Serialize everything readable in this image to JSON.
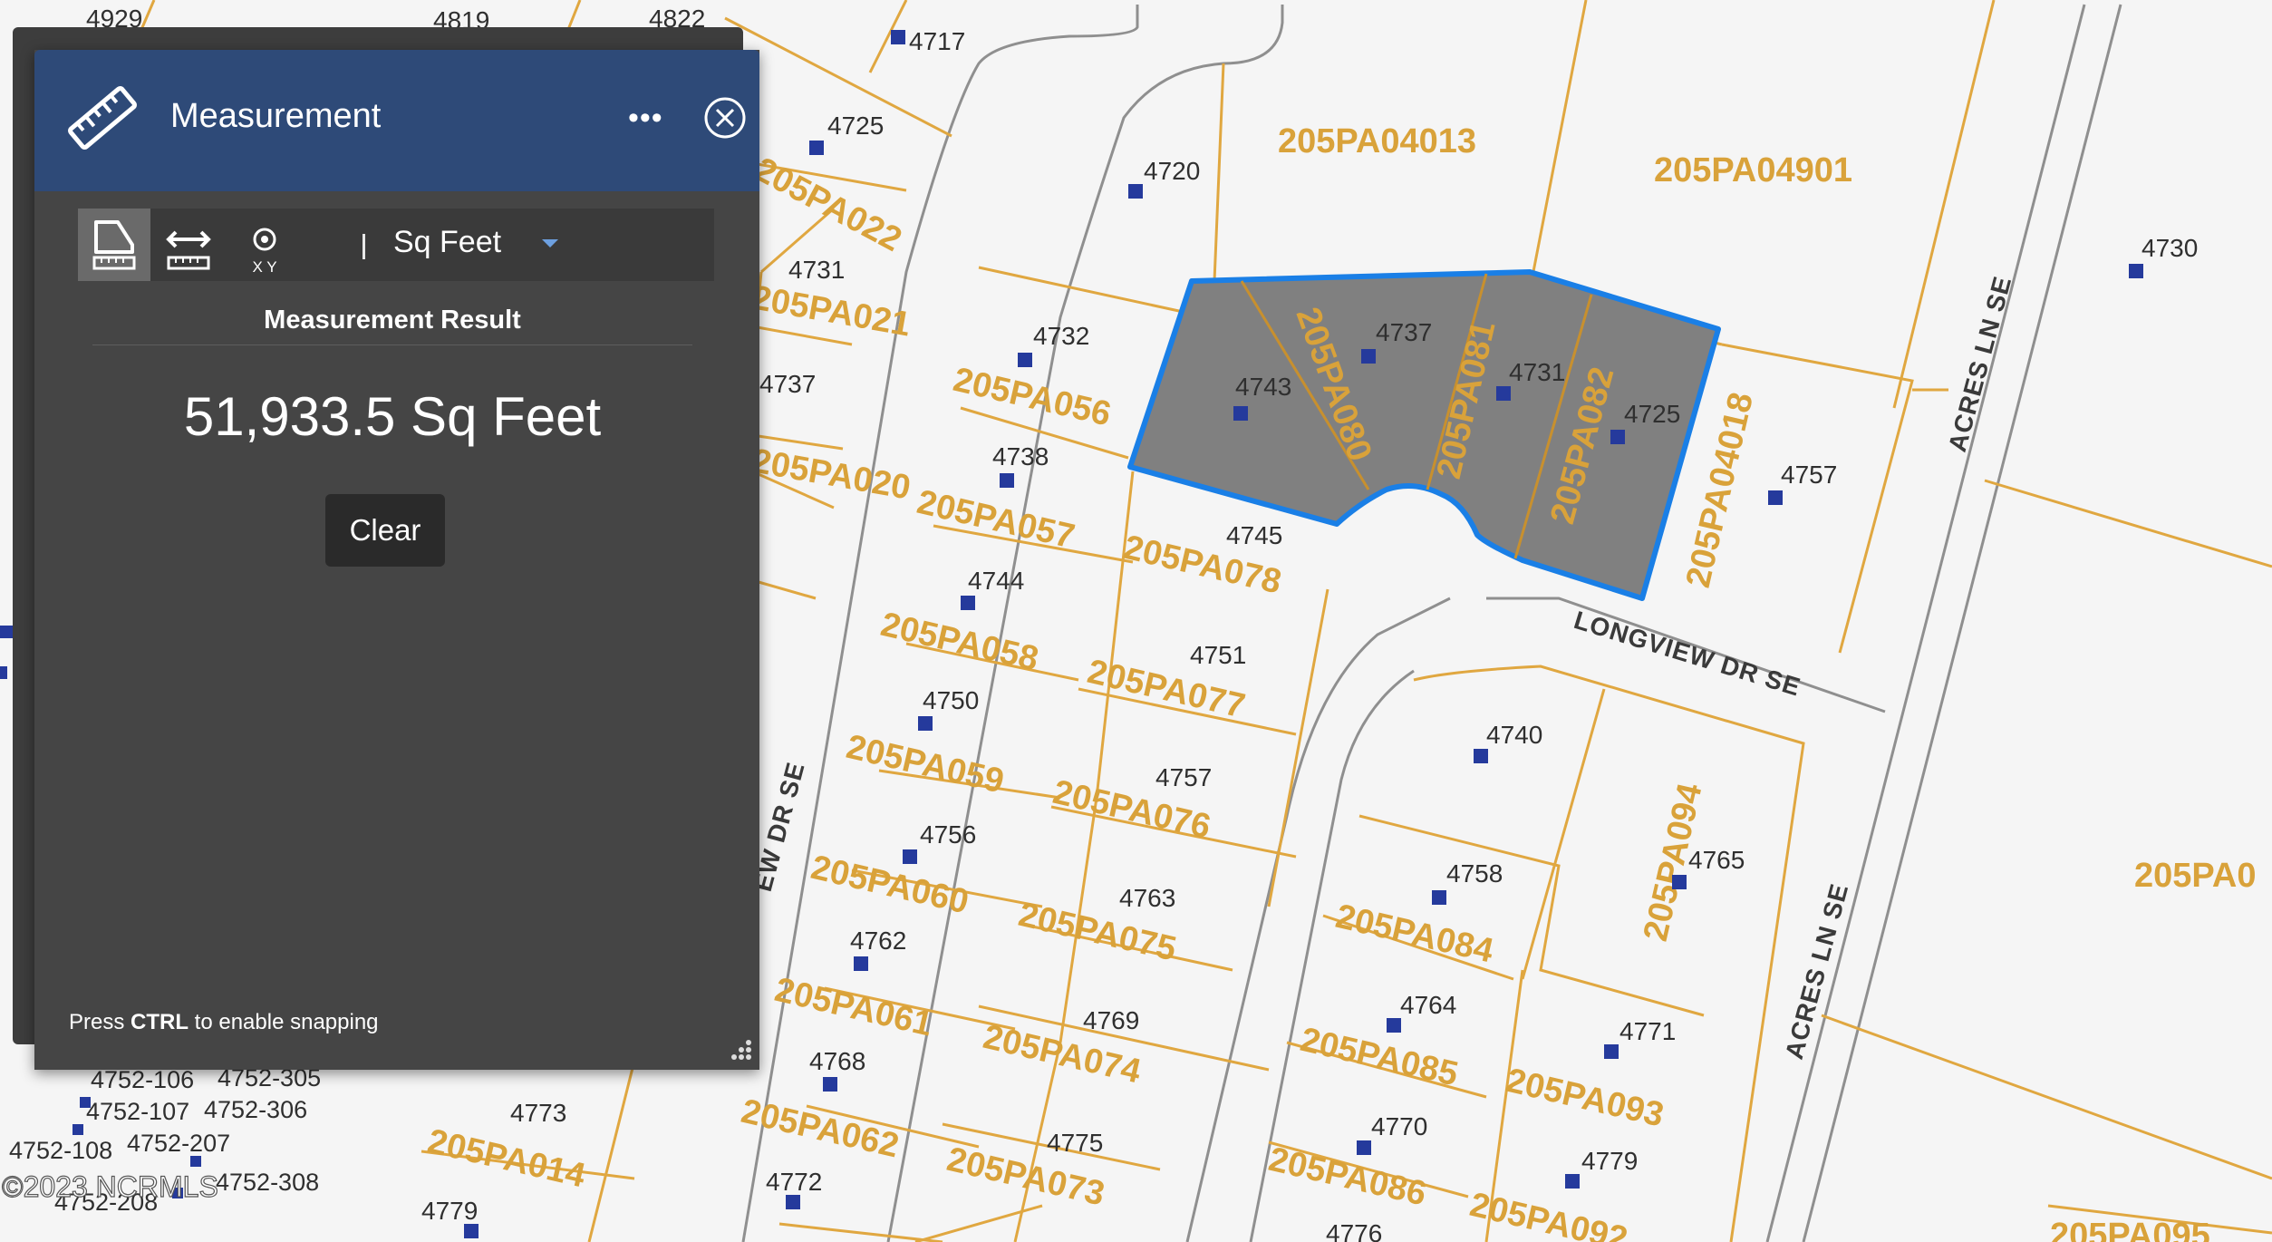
{
  "panel": {
    "title": "Measurement",
    "more_label": "•••",
    "unit_label": "Sq Feet",
    "result_label": "Measurement Result",
    "result_value": "51,933.5 Sq Feet",
    "clear_label": "Clear",
    "hint_prefix": "Press ",
    "hint_key": "CTRL",
    "hint_suffix": " to enable snapping",
    "location_xy_label": "X Y"
  },
  "map": {
    "colors": {
      "parcel_line": "#e0a740",
      "parcel_label": "#d9a23a",
      "selection_fill": "#808080",
      "selection_outline": "#1a7fe6",
      "address_marker": "#253a9c",
      "road": "#9a9a9a"
    },
    "parcel_ids": [
      "205PA04013",
      "205PA04901",
      "205PA022",
      "205PA021",
      "205PA020",
      "205PA056",
      "205PA080",
      "205PA081",
      "205PA082",
      "205PA04018",
      "205PA057",
      "205PA078",
      "205PA058",
      "205PA077",
      "205PA059",
      "205PA076",
      "205PA060",
      "205PA075",
      "205PA061",
      "205PA074",
      "205PA062",
      "205PA073",
      "205PA014",
      "205PA094",
      "205PA084",
      "205PA085",
      "205PA093",
      "205PA086",
      "205PA092",
      "205PA095",
      "205PA0"
    ],
    "addresses": [
      "4929",
      "4819",
      "4822",
      "4717",
      "4725",
      "4720",
      "4731",
      "4737",
      "4732",
      "4743",
      "4737",
      "4731",
      "4725",
      "4738",
      "4757",
      "4730",
      "4745",
      "4744",
      "4751",
      "4750",
      "4740",
      "4757",
      "4756",
      "4758",
      "4765",
      "4763",
      "4762",
      "4764",
      "4771",
      "4769",
      "4768",
      "4770",
      "4775",
      "4779",
      "4773",
      "4772",
      "4779",
      "4776",
      "4752-106",
      "4752-305",
      "4752-107",
      "4752-306",
      "4752-108",
      "4752-207",
      "4752-208",
      "4752-308"
    ],
    "roads": [
      "LONGVIEW DR SE",
      "ACRES LN SE",
      "ACRES LN SE",
      "EW DR SE"
    ],
    "copyright": "©2023 NCRMLS"
  }
}
